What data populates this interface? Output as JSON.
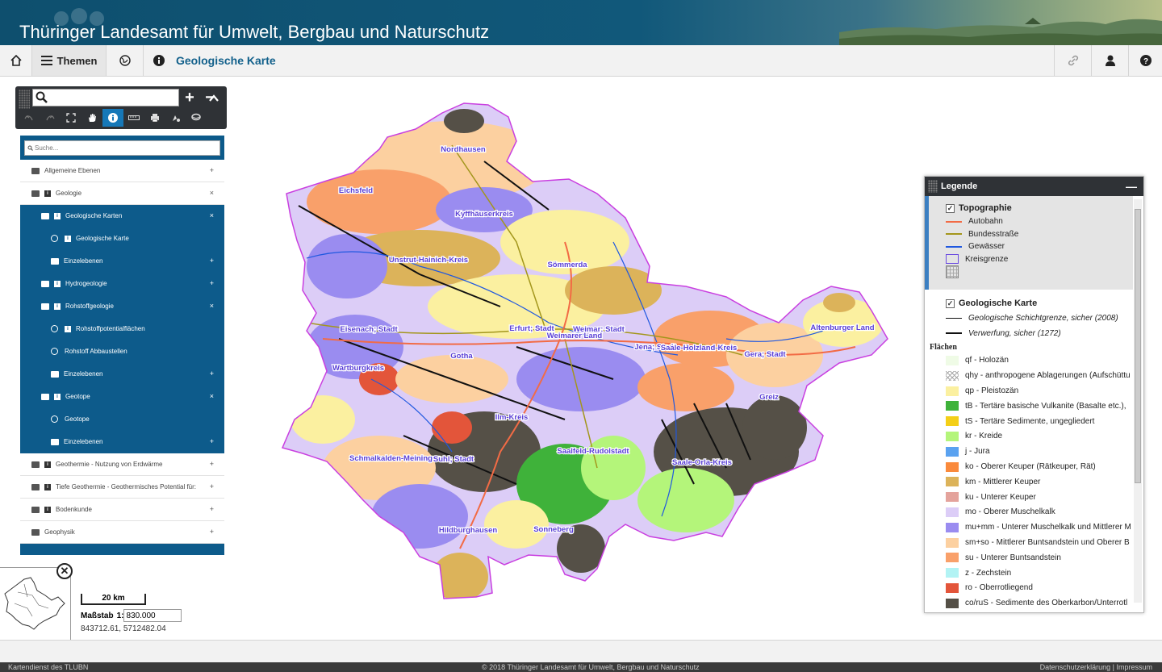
{
  "header": {
    "title": "Thüringer Landesamt für Umwelt, Bergbau und Naturschutz"
  },
  "navbar": {
    "themen_label": "Themen",
    "page_title": "Geologische Karte"
  },
  "toolbar": {
    "search_placeholder": "",
    "zoom_in": "+",
    "zoom_out": "−",
    "collapse": "^",
    "tools": [
      "undo-icon",
      "redo-icon",
      "fullscreen-icon",
      "pan-icon",
      "info-icon",
      "measure-icon",
      "print-icon",
      "draw-icon",
      "layer-tool-icon"
    ],
    "active_tool": "info-icon"
  },
  "layers": {
    "search_placeholder": "Suche...",
    "items": [
      {
        "label": "Allgemeine Ebenen",
        "indent": 0,
        "info": false,
        "globe": false,
        "selected": false,
        "action": "+"
      },
      {
        "label": "Geologie",
        "indent": 0,
        "info": true,
        "globe": false,
        "selected": false,
        "action": "×"
      },
      {
        "label": "Geologische Karten",
        "indent": 1,
        "info": true,
        "globe": false,
        "selected": true,
        "action": "×"
      },
      {
        "label": "Geologische Karte",
        "indent": 2,
        "info": true,
        "globe": true,
        "selected": true,
        "action": ""
      },
      {
        "label": "Einzelebenen",
        "indent": 2,
        "info": false,
        "globe": false,
        "selected": true,
        "action": "+"
      },
      {
        "label": "Hydrogeologie",
        "indent": 1,
        "info": true,
        "globe": false,
        "selected": true,
        "action": "+"
      },
      {
        "label": "Rohstoffgeologie",
        "indent": 1,
        "info": true,
        "globe": false,
        "selected": true,
        "action": "×"
      },
      {
        "label": "Rohstoffpotentialflächen",
        "indent": 2,
        "info": true,
        "globe": true,
        "selected": true,
        "action": ""
      },
      {
        "label": "Rohstoff Abbaustellen",
        "indent": 2,
        "info": false,
        "globe": true,
        "selected": true,
        "action": ""
      },
      {
        "label": "Einzelebenen",
        "indent": 2,
        "info": false,
        "globe": false,
        "selected": true,
        "action": "+"
      },
      {
        "label": "Geotope",
        "indent": 1,
        "info": true,
        "globe": false,
        "selected": true,
        "action": "×"
      },
      {
        "label": "Geotope",
        "indent": 2,
        "info": false,
        "globe": true,
        "selected": true,
        "action": ""
      },
      {
        "label": "Einzelebenen",
        "indent": 2,
        "info": false,
        "globe": false,
        "selected": true,
        "action": "+"
      },
      {
        "label": "Geothermie - Nutzung von Erdwärme",
        "indent": 0,
        "info": true,
        "globe": false,
        "selected": false,
        "action": "+"
      },
      {
        "label": "Tiefe Geothermie - Geothermisches Potential für:",
        "indent": 0,
        "info": true,
        "globe": false,
        "selected": false,
        "action": "+"
      },
      {
        "label": "Bodenkunde",
        "indent": 0,
        "info": true,
        "globe": false,
        "selected": false,
        "action": "+"
      },
      {
        "label": "Geophysik",
        "indent": 0,
        "info": false,
        "globe": false,
        "selected": false,
        "action": "+"
      }
    ]
  },
  "map": {
    "labels": [
      "Nordhausen",
      "Eichsfeld",
      "Kyffhäuserkreis",
      "Unstrut-Hainich-Kreis",
      "Sömmerda",
      "Eisenach; Stadt",
      "Erfurt; Stadt",
      "Weimar; Stadt",
      "Weimarer Land",
      "Jena; Stadt",
      "Saale-Holzland-Kreis",
      "Gera; Stadt",
      "Altenburger Land",
      "Gotha",
      "Wartburgkreis",
      "Greiz",
      "Ilm-Kreis",
      "Schmalkalden-Meiningen",
      "Suhl; Stadt",
      "Saalfeld-Rudolstadt",
      "Saale-Orla-Kreis",
      "Hildburghausen",
      "Sonneberg"
    ]
  },
  "scale": {
    "bar_label": "20 km",
    "scale_label": "Maßstab",
    "scale_prefix": "1:",
    "scale_value": "830.000",
    "coordinates": "843712.61, 5712482.04"
  },
  "legend": {
    "title": "Legende",
    "minimize": "—",
    "topo": {
      "title": "Topographie",
      "items": [
        {
          "label": "Autobahn",
          "color": "#f26b45",
          "type": "line"
        },
        {
          "label": "Bundesstraße",
          "color": "#a3961c",
          "type": "line"
        },
        {
          "label": "Gewässer",
          "color": "#1f58e0",
          "type": "line"
        },
        {
          "label": "Kreisgrenze",
          "color": "#6b4be0",
          "type": "box"
        },
        {
          "label": "",
          "color": "#888888",
          "type": "grid"
        }
      ]
    },
    "geo": {
      "title": "Geologische Karte",
      "lines": [
        {
          "label": "Geologische Schichtgrenze, sicher (2008)",
          "width": 1
        },
        {
          "label": "Verwerfung, sicher (1272)",
          "width": 2
        }
      ],
      "flaechen_label": "Flächen",
      "areas": [
        {
          "label": "qf - Holozän",
          "color": "#effbe6"
        },
        {
          "label": "qhy - anthropogene Ablagerungen (Aufschüttu",
          "color": "hatch"
        },
        {
          "label": "qp - Pleistozän",
          "color": "#fbf0a0"
        },
        {
          "label": "tB - Tertäre basische Vulkanite (Basalte etc.), ",
          "color": "#3fb23a"
        },
        {
          "label": "tS - Tertäre Sedimente, ungegliedert",
          "color": "#f4cf17"
        },
        {
          "label": "kr - Kreide",
          "color": "#b4f57a"
        },
        {
          "label": "j - Jura",
          "color": "#5aa2f0"
        },
        {
          "label": "ko - Oberer Keuper (Rätkeuper, Rät)",
          "color": "#fa8a3c"
        },
        {
          "label": "km - Mittlerer Keuper",
          "color": "#dcb35a"
        },
        {
          "label": "ku - Unterer Keuper",
          "color": "#e4a39c"
        },
        {
          "label": "mo - Oberer Muschelkalk",
          "color": "#dccdf7"
        },
        {
          "label": "mu+mm - Unterer Muschelkalk und Mittlerer M",
          "color": "#9a8cf0"
        },
        {
          "label": "sm+so - Mittlerer Buntsandstein und Oberer B",
          "color": "#fcd0a0"
        },
        {
          "label": "su - Unterer Buntsandstein",
          "color": "#f9a06a"
        },
        {
          "label": "z - Zechstein",
          "color": "#b2f3f4"
        },
        {
          "label": "ro - Oberrotliegend",
          "color": "#e3553a"
        },
        {
          "label": "co/ruS - Sedimente des Oberkarbon/Unterrotl",
          "color": "#555047"
        }
      ]
    }
  },
  "footer": {
    "left": "Kartendienst des TLUBN",
    "center": "© 2018 Thüringer Landesamt für Umwelt, Bergbau und Naturschutz",
    "right": "Datenschutzerklärung  |  Impressum"
  }
}
